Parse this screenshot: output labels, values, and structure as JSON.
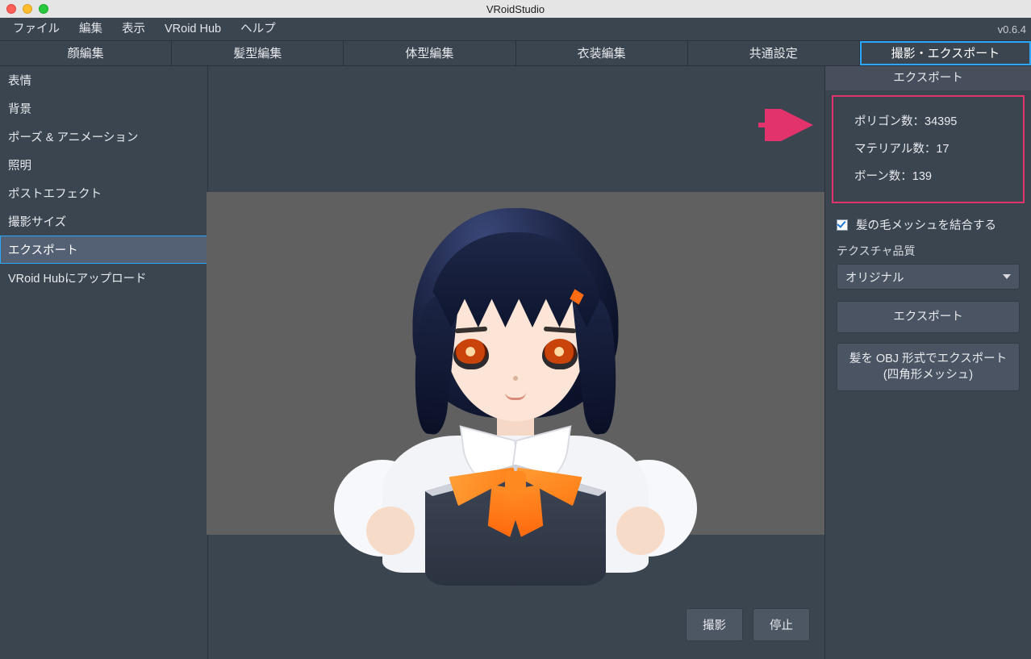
{
  "window": {
    "title": "VRoidStudio",
    "version": "v0.6.4"
  },
  "menubar": [
    "ファイル",
    "編集",
    "表示",
    "VRoid Hub",
    "ヘルプ"
  ],
  "tabs": [
    "顔編集",
    "髪型編集",
    "体型編集",
    "衣装編集",
    "共通設定",
    "撮影・エクスポート"
  ],
  "active_tab": 5,
  "sidebar": {
    "items": [
      "表情",
      "背景",
      "ポーズ & アニメーション",
      "照明",
      "ポストエフェクト",
      "撮影サイズ",
      "エクスポート",
      "VRoid Hubにアップロード"
    ],
    "selected": 6
  },
  "center": {
    "capture_btn": "撮影",
    "stop_btn": "停止"
  },
  "rightpanel": {
    "header": "エクスポート",
    "stats": {
      "polygons_label": "ポリゴン数：",
      "polygons_value": "34395",
      "materials_label": "マテリアル数：",
      "materials_value": "17",
      "bones_label": "ボーン数：",
      "bones_value": "139"
    },
    "merge_hair_checkbox_label": "髪の毛メッシュを結合する",
    "merge_hair_checked": true,
    "texture_quality_label": "テクスチャ品質",
    "texture_quality_value": "オリジナル",
    "export_btn": "エクスポート",
    "export_obj_btn_line1": "髪を OBJ 形式でエクスポート",
    "export_obj_btn_line2": "(四角形メッシュ)"
  },
  "colors": {
    "highlight_pink": "#e2336d",
    "highlight_blue": "#2ba7ff"
  }
}
